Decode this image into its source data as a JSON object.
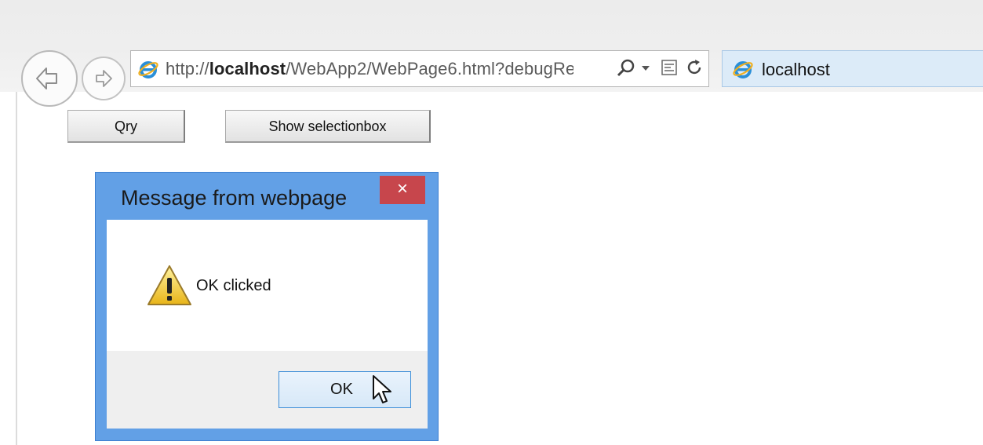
{
  "browser": {
    "url_prefix": "http://",
    "url_host": "localhost",
    "url_path": "/WebApp2/WebPage6.html?debugRe",
    "tab_title": "localhost"
  },
  "page": {
    "buttons": {
      "qry": "Qry",
      "show_selectionbox": "Show selectionbox"
    }
  },
  "dialog": {
    "title": "Message from webpage",
    "close_glyph": "×",
    "message": "OK clicked",
    "ok_label": "OK"
  },
  "icons": {
    "back": "back-arrow-icon",
    "forward": "forward-arrow-icon",
    "ie": "internet-explorer-icon",
    "search": "search-icon",
    "dropdown": "dropdown-arrow-icon",
    "compat": "compatibility-view-icon",
    "refresh": "refresh-icon",
    "warning": "warning-icon",
    "cursor": "mouse-pointer-icon"
  }
}
